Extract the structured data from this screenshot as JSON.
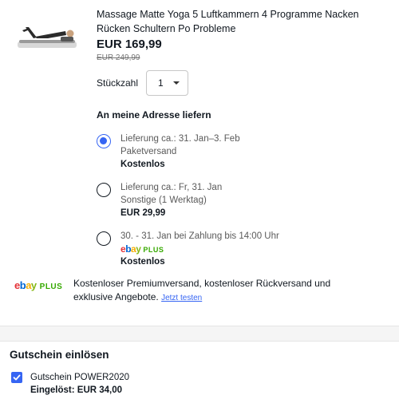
{
  "product": {
    "title": "Massage Matte Yoga 5 Luftkammern 4 Programme Nacken Rücken Schultern Po Probleme",
    "price": "EUR 169,99",
    "old_price": "EUR 249,99"
  },
  "quantity": {
    "label": "Stückzahl",
    "value": "1"
  },
  "shipping": {
    "heading": "An meine Adresse liefern",
    "options": [
      {
        "line1": "Lieferung ca.: 31. Jan–3. Feb",
        "line2": "Paketversand",
        "cost": "Kostenlos",
        "selected": true
      },
      {
        "line1": "Lieferung ca.: Fr, 31. Jan",
        "line2": "Sonstige (1 Werktag)",
        "cost": "EUR 29,99",
        "selected": false
      },
      {
        "line1": "30. - 31. Jan bei Zahlung bis 14:00 Uhr",
        "logo_ebay": "ebay",
        "logo_plus": "PLUS",
        "cost": "Kostenlos",
        "selected": false
      }
    ]
  },
  "promo": {
    "logo_ebay": "ebay",
    "logo_plus": "PLUS",
    "text": "Kostenloser Premiumversand, kostenloser Rückversand und exklusive Angebote.",
    "link": "Jetzt testen"
  },
  "voucher": {
    "heading": "Gutschein einlösen",
    "code_label": "Gutschein POWER2020",
    "redeemed": "Eingelöst: EUR 34,00",
    "checked": true
  },
  "icons": [
    "product-thumbnail-icon",
    "chevron-down-icon",
    "checkmark-icon"
  ],
  "colors": {
    "accent": "#3665f3",
    "text": "#111820",
    "muted": "#767676",
    "plus_green": "#36a900",
    "separator": "#f5f5f5"
  }
}
